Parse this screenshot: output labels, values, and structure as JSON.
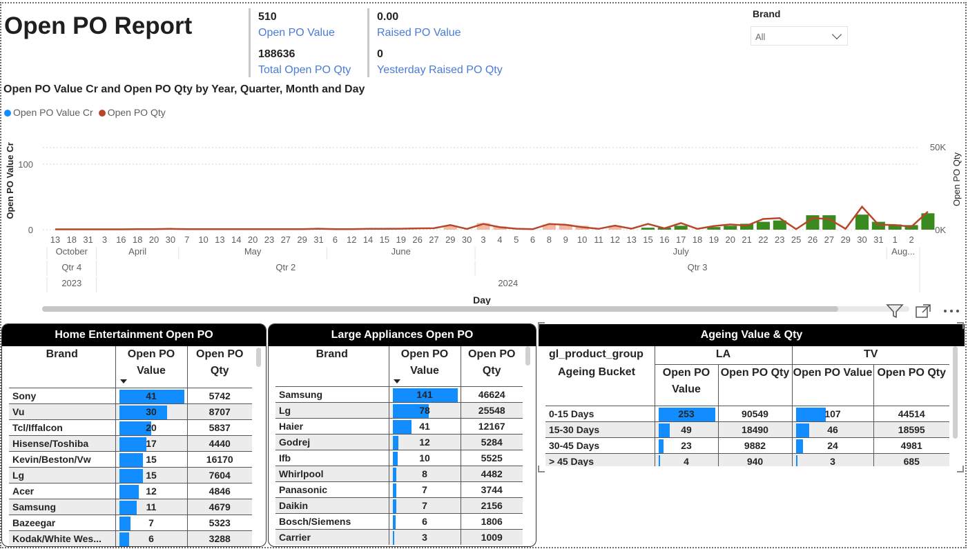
{
  "report_title": "Open PO Report",
  "kpis": [
    {
      "value": "510",
      "label": "Open PO Value"
    },
    {
      "value": "0.00",
      "label": "Raised PO Value"
    },
    {
      "value": "188636",
      "label": "Total Open PO Qty"
    },
    {
      "value": "0",
      "label": "Yesterday Raised PO Qty"
    }
  ],
  "brand_slicer": {
    "title": "Brand",
    "selected": "All",
    "icon": "chevron-down-icon"
  },
  "combo_chart": {
    "title": "Open PO Value Cr and Open PO Qty by Year, Quarter, Month and Day",
    "legend": [
      "Open PO Value Cr",
      "Open PO Qty"
    ],
    "colors": {
      "value": "#118dff",
      "qty": "#b7472a",
      "bar_neg": "#f4b8a2",
      "bar_pos": "#3a8a1f",
      "legend_value": "#118dff",
      "legend_qty": "#b7472a"
    }
  },
  "chart_data": {
    "type": "bar",
    "title": "Open PO Value Cr and Open PO Qty by Year, Quarter, Month and Day",
    "xlabel": "Day",
    "ylabel": "Open PO Value Cr",
    "y2label": "Open PO Qty",
    "ylim": [
      0,
      100
    ],
    "yticks": [
      "0",
      "100"
    ],
    "y2lim": [
      0,
      50000
    ],
    "y2ticks": [
      "0K",
      "50K"
    ],
    "categories": [
      "13",
      "18",
      "31",
      "3",
      "16",
      "18",
      "20",
      "30",
      "7",
      "10",
      "13",
      "14",
      "20",
      "23",
      "27",
      "29",
      "31",
      "6",
      "12",
      "14",
      "15",
      "19",
      "26",
      "27",
      "29",
      "30",
      "3",
      "4",
      "5",
      "6",
      "8",
      "9",
      "10",
      "11",
      "12",
      "13",
      "15",
      "16",
      "17",
      "18",
      "19",
      "20",
      "21",
      "22",
      "23",
      "25",
      "26",
      "27",
      "29",
      "30",
      "31",
      "1",
      "2"
    ],
    "months": [
      {
        "label": "October",
        "from": 0,
        "to": 2
      },
      {
        "label": "April",
        "from": 3,
        "to": 7
      },
      {
        "label": "May",
        "from": 8,
        "to": 16
      },
      {
        "label": "June",
        "from": 17,
        "to": 25
      },
      {
        "label": "July",
        "from": 26,
        "to": 50
      },
      {
        "label": "Aug...",
        "from": 51,
        "to": 52
      }
    ],
    "quarters": [
      {
        "label": "Qtr 4",
        "from": 0,
        "to": 2
      },
      {
        "label": "Qtr 2",
        "from": 3,
        "to": 25
      },
      {
        "label": "Qtr 3",
        "from": 26,
        "to": 52
      }
    ],
    "years": [
      {
        "label": "2023",
        "from": 0,
        "to": 2
      },
      {
        "label": "2024",
        "from": 3,
        "to": 52
      }
    ],
    "series": [
      {
        "name": "Open PO Value Cr",
        "values": [
          0,
          0,
          0,
          0,
          0,
          0,
          0,
          0,
          0,
          0,
          0,
          0,
          0,
          0,
          0,
          0,
          0,
          0,
          0,
          0,
          0,
          0,
          0,
          0,
          6,
          0,
          10,
          5,
          0,
          0,
          8,
          8,
          6,
          0,
          6,
          0,
          3,
          3,
          6,
          0,
          4,
          6,
          9,
          12,
          14,
          0,
          22,
          22,
          0,
          23,
          12,
          8,
          7,
          25
        ]
      },
      {
        "name": "Open PO Qty",
        "values": [
          200,
          200,
          200,
          200,
          200,
          300,
          300,
          500,
          300,
          300,
          300,
          300,
          300,
          300,
          300,
          300,
          600,
          300,
          300,
          500,
          500,
          600,
          800,
          900,
          2800,
          400,
          3500,
          1500,
          600,
          300,
          3500,
          3000,
          1500,
          500,
          2500,
          600,
          3500,
          800,
          4000,
          500,
          2200,
          3200,
          2500,
          6500,
          7000,
          300,
          7000,
          6500,
          500,
          14000,
          3000,
          2800,
          1800,
          11000
        ]
      }
    ]
  },
  "home_ent": {
    "title": "Home Entertainment Open PO",
    "cols": [
      "Brand",
      "Open PO Value",
      "Open PO Qty"
    ],
    "rows": [
      {
        "brand": "Sony",
        "value": 41,
        "qty": "5742"
      },
      {
        "brand": "Vu",
        "value": 30,
        "qty": "8707"
      },
      {
        "brand": "Tcl/Iffalcon",
        "value": 20,
        "qty": "5837"
      },
      {
        "brand": "Hisense/Toshiba",
        "value": 17,
        "qty": "4440"
      },
      {
        "brand": "Kevin/Beston/Vw",
        "value": 15,
        "qty": "16170"
      },
      {
        "brand": "Lg",
        "value": 15,
        "qty": "7604"
      },
      {
        "brand": "Acer",
        "value": 12,
        "qty": "4846"
      },
      {
        "brand": "Samsung",
        "value": 11,
        "qty": "4679"
      },
      {
        "brand": "Bazeegar",
        "value": 7,
        "qty": "5323"
      },
      {
        "brand": "Kodak/White Wes...",
        "value": 6,
        "qty": "3288"
      }
    ]
  },
  "large_app": {
    "title": "Large Appliances Open PO",
    "cols": [
      "Brand",
      "Open PO Value",
      "Open PO Qty"
    ],
    "rows": [
      {
        "brand": "Samsung",
        "value": 141,
        "qty": "46624"
      },
      {
        "brand": "Lg",
        "value": 78,
        "qty": "25548"
      },
      {
        "brand": "Haier",
        "value": 41,
        "qty": "12167"
      },
      {
        "brand": "Godrej",
        "value": 12,
        "qty": "5284"
      },
      {
        "brand": "Ifb",
        "value": 10,
        "qty": "5525"
      },
      {
        "brand": "Whirlpool",
        "value": 8,
        "qty": "4482"
      },
      {
        "brand": "Panasonic",
        "value": 7,
        "qty": "3744"
      },
      {
        "brand": "Daikin",
        "value": 7,
        "qty": "2156"
      },
      {
        "brand": "Bosch/Siemens",
        "value": 6,
        "qty": "1806"
      },
      {
        "brand": "Carrier",
        "value": 3,
        "qty": "1009"
      }
    ]
  },
  "ageing": {
    "title": "Ageing Value & Qty",
    "group_header": "gl_product_group",
    "groups": [
      "LA",
      "TV"
    ],
    "row_header": "Ageing Bucket",
    "cols": [
      "Open PO Value",
      "Open PO Qty",
      "Open PO Value",
      "Open PO Qty"
    ],
    "rows": [
      {
        "bucket": "0-15 Days",
        "la_value": 253,
        "la_qty": "90549",
        "tv_value": 107,
        "tv_qty": "44514"
      },
      {
        "bucket": "15-30 Days",
        "la_value": 49,
        "la_qty": "18490",
        "tv_value": 46,
        "tv_qty": "18595"
      },
      {
        "bucket": "30-45 Days",
        "la_value": 23,
        "la_qty": "9882",
        "tv_value": 24,
        "tv_qty": "4981"
      },
      {
        "bucket": "> 45 Days",
        "la_value": 4,
        "la_qty": "940",
        "tv_value": 3,
        "tv_qty": "685"
      }
    ]
  },
  "visual_icons": [
    "filter-icon",
    "focus-mode-icon",
    "more-options-icon"
  ]
}
